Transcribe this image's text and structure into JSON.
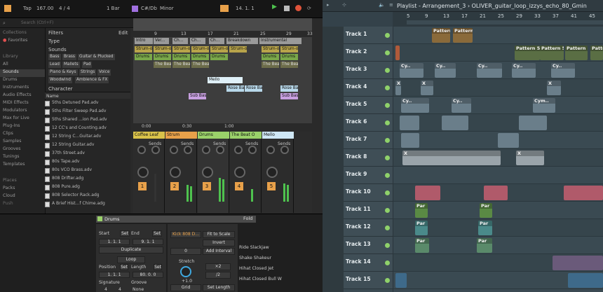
{
  "ableton": {
    "transport": {
      "tap": "Tap",
      "bpm": "167.00",
      "sig": "4 / 4",
      "quant": "1 Bar",
      "key": "C#/Db",
      "scale": "Minor",
      "position": "14.  1.  1"
    },
    "search_placeholder": "Search (Ctrl+F)",
    "sidebar": {
      "collections_head": "Collections",
      "favorites": "Favorites",
      "library_head": "Library",
      "items": [
        "All",
        "Sounds",
        "Drums",
        "Instruments",
        "Audio Effects",
        "MIDI Effects",
        "Modulators",
        "Max for Live",
        "Plug-Ins",
        "Clips",
        "Samples",
        "Grooves",
        "Tunings",
        "Templates"
      ],
      "places_head": "Places",
      "places": [
        "Packs",
        "Cloud",
        "Push"
      ]
    },
    "filters": {
      "title": "Filters",
      "edit": "Edit",
      "type": "Type",
      "sounds": "Sounds",
      "chips": [
        "Bass",
        "Brass",
        "Guitar & Plucked",
        "Lead",
        "Mallets",
        "Pad",
        "Piano & Keys",
        "Strings",
        "Voice",
        "Woodwind",
        "Ambience & FX"
      ],
      "character": "Character",
      "name_col": "Name"
    },
    "files": [
      "5ths Detuned Pad.adv",
      "5ths Filter Sweep Pad.adv",
      "5ths Shared ...ion Pad.adv",
      "12 CC's and Counting.adv",
      "12 String C...Guitar.adv",
      "12 String Guitar.adv",
      "37th Street.adv",
      "80s Tape.adv",
      "80s VCO Brass.adv",
      "808 Drifter.adg",
      "808 Pure.adg",
      "808 Selector Rack.adg",
      "A Brief Hist...f Chime.adg"
    ],
    "arrangement": {
      "ruler": [
        "9",
        "13",
        "17",
        "21",
        "25",
        "29",
        "33"
      ],
      "sections": [
        "Intro",
        "Ver...",
        "Ch...",
        "Ch...",
        "Ch...",
        "Breakdown",
        "Instrumental"
      ],
      "clip_labels": [
        "Strum-o",
        "Strum-o",
        "Strum-o",
        "Strum-o",
        "Strum-o",
        "Strum-o",
        "Strum-o",
        "Strum-o",
        "Drums",
        "Drums",
        "Drums",
        "Drums",
        "Drums",
        "Drums",
        "Drums",
        "The Bea",
        "The Bea",
        "The Bea",
        "The Bea",
        "The Bea",
        "Mello",
        "Rose Bas",
        "Rose Bas",
        "Rose Bas",
        "Sub Bas",
        "Sub Bas"
      ],
      "times": [
        "0:00",
        "0:30",
        "1:00"
      ]
    },
    "mixer": {
      "strips": [
        {
          "name": "Coffee Leaf",
          "num": "1",
          "color": "#d9c24a"
        },
        {
          "name": "Strum",
          "num": "2",
          "color": "#e8a14a"
        },
        {
          "name": "Drums",
          "num": "3",
          "color": "#9ad16a"
        },
        {
          "name": "The Beat O",
          "num": "4",
          "color": "#9ad16a"
        },
        {
          "name": "Mello",
          "num": "5",
          "color": "#cfe7f5"
        }
      ],
      "sends": "Sends",
      "a": "A",
      "b": "B",
      "s": "S"
    },
    "clip_view": {
      "title": "Drums",
      "fold": "Fold",
      "start": "Start",
      "set": "Set",
      "end": "End",
      "start_val": "1.  1.  1",
      "end_val": "9.  1.  1",
      "duplicate": "Duplicate",
      "loop": "Loop",
      "position": "Position",
      "length": "Length",
      "pos_val": "1.  1.  1",
      "len_val": "80.  0.  0",
      "signature": "Signature",
      "groove": "Groove",
      "sig_num": "4",
      "sig_den": "4",
      "groove_val": "None",
      "sample": "Kick 808 D...",
      "fit": "Fit to Scale",
      "invert": "Invert",
      "zero": "0",
      "add_interval": "Add Interval",
      "stretch": "Stretch",
      "stretch_val": "+1.0",
      "x2": "×2",
      "half": "/2",
      "grid": "Grid",
      "set_length": "Set Length",
      "sample_list": [
        "Ride Slackjaw",
        "Shake Shakeur",
        "Hihat Closed Jet",
        "Hihat Closed Bull W"
      ]
    }
  },
  "fl": {
    "title": "Playlist - Arrangement_3 › OLIVER_guitar_loop_izzys_echo_80_Gmin",
    "ruler": [
      "5",
      "9",
      "13",
      "17",
      "21",
      "25",
      "29",
      "33",
      "37",
      "41",
      "45"
    ],
    "tracks": [
      "Track 1",
      "Track 2",
      "Track 3",
      "Track 4",
      "Track 5",
      "Track 6",
      "Track 7",
      "Track 8",
      "Track 9",
      "Track 10",
      "Track 11",
      "Track 12",
      "Track 13",
      "Track 14",
      "Track 15"
    ],
    "labels": {
      "pattern3": "Pattern 3",
      "pattern4": "Pattern 4",
      "pattern5": "Pattern 5",
      "cy": "Cy..",
      "cym": "Cym..",
      "par": "Par",
      "x": "X"
    }
  }
}
